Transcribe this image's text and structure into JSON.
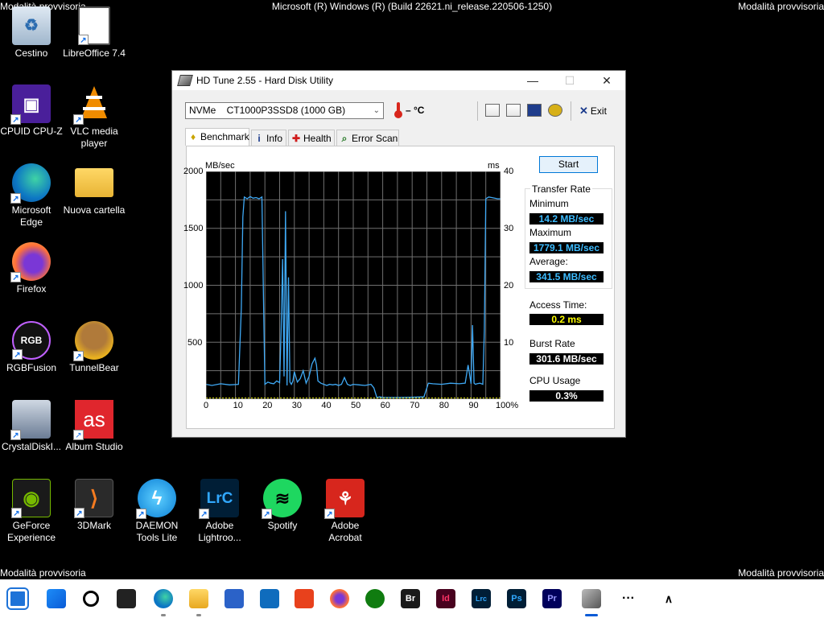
{
  "screen": {
    "safe_mode_label": "Modalità provvisoria",
    "build_text": "Microsoft (R) Windows (R) (Build 22621.ni_release.220506-1250)"
  },
  "desktop": {
    "icons": [
      {
        "label": "Cestino",
        "icon": "recycle-bin-icon"
      },
      {
        "label": "LibreOffice 7.4",
        "icon": "libreoffice-icon"
      },
      {
        "label": "CPUID CPU-Z",
        "icon": "cpuz-icon"
      },
      {
        "label": "VLC media player",
        "icon": "vlc-icon"
      },
      {
        "label": "Microsoft Edge",
        "icon": "edge-icon"
      },
      {
        "label": "Nuova cartella",
        "icon": "folder-icon"
      },
      {
        "label": "Firefox",
        "icon": "firefox-icon"
      },
      {
        "label": "RGBFusion",
        "icon": "rgbfusion-icon"
      },
      {
        "label": "TunnelBear",
        "icon": "tunnelbear-icon"
      },
      {
        "label": "CrystalDiskI...",
        "icon": "crystaldisk-icon"
      },
      {
        "label": "Album Studio",
        "icon": "album-studio-icon"
      },
      {
        "label": "GeForce Experience",
        "icon": "geforce-icon"
      },
      {
        "label": "3DMark",
        "icon": "3dmark-icon"
      },
      {
        "label": "DAEMON Tools Lite",
        "icon": "daemon-tools-icon"
      },
      {
        "label": "Adobe Lightroo...",
        "icon": "lightroom-icon",
        "glyph": "LrC"
      },
      {
        "label": "Spotify",
        "icon": "spotify-icon"
      },
      {
        "label": "Adobe Acrobat",
        "icon": "acrobat-icon"
      },
      {
        "label": "",
        "icon": "album-studio-glyph",
        "glyph": "as"
      },
      {
        "label": "",
        "icon": "rgb-glyph",
        "glyph": "RGB"
      }
    ]
  },
  "window": {
    "title": "HD Tune 2.55 - Hard Disk Utility",
    "controls": {
      "minimize": "—",
      "maximize": "☐",
      "close": "✕"
    },
    "drive_select": "NVMe    CT1000P3SSD8 (1000 GB)",
    "temperature": "– °C",
    "exit_label": "Exit",
    "tabs": [
      {
        "label": "Benchmark",
        "active": true
      },
      {
        "label": "Info"
      },
      {
        "label": "Health"
      },
      {
        "label": "Error Scan"
      }
    ],
    "start_label": "Start",
    "transfer_rate": {
      "title": "Transfer Rate",
      "min_label": "Minimum",
      "min_value": "14.2 MB/sec",
      "max_label": "Maximum",
      "max_value": "1779.1 MB/sec",
      "avg_label": "Average:",
      "avg_value": "341.5 MB/sec"
    },
    "access_time": {
      "label": "Access Time:",
      "value": "0.2 ms"
    },
    "burst_rate": {
      "label": "Burst Rate",
      "value": "301.6 MB/sec"
    },
    "cpu_usage": {
      "label": "CPU Usage",
      "value": "0.3%"
    }
  },
  "chart_data": {
    "type": "line",
    "ylabel_left": "MB/sec",
    "ylabel_right": "ms",
    "ylim_left": [
      0,
      2000
    ],
    "ylim_right": [
      0,
      40
    ],
    "yticks_left": [
      "2000",
      "1500",
      "1000",
      "500"
    ],
    "yticks_right": [
      "40",
      "30",
      "20",
      "10"
    ],
    "xlim": [
      0,
      100
    ],
    "xticks": [
      "0",
      "10",
      "20",
      "30",
      "40",
      "50",
      "60",
      "70",
      "80",
      "90",
      "100%"
    ],
    "grid": true,
    "colors": {
      "background": "#000000",
      "grid": "#707070",
      "transfer": "#3fa9f5",
      "access": "#e8e800"
    },
    "series": [
      {
        "axis": "left",
        "x": [
          0,
          2,
          5,
          8,
          11,
          12,
          12.5,
          13,
          14,
          15,
          16,
          17,
          18,
          19,
          19.5,
          20,
          21,
          22,
          23,
          24,
          25,
          25.5,
          26,
          26.5,
          27,
          27.5,
          28,
          28.5,
          29,
          29.5,
          30,
          31,
          32,
          33,
          34,
          35,
          36,
          37,
          37.5,
          38,
          39,
          40,
          41,
          42,
          43,
          44,
          45,
          46,
          47,
          48,
          49,
          50,
          52,
          54,
          56,
          57,
          58,
          59,
          60,
          65,
          70,
          74,
          75,
          75.5,
          77,
          80,
          83,
          86,
          88,
          89,
          90,
          90.5,
          91,
          91.5,
          92,
          93,
          94,
          94.5,
          95,
          96,
          97,
          98,
          99,
          100
        ],
        "values": [
          130,
          120,
          135,
          125,
          130,
          800,
          1600,
          1775,
          1760,
          1779,
          1765,
          1770,
          1760,
          1775,
          900,
          130,
          150,
          140,
          135,
          160,
          145,
          600,
          1230,
          200,
          1650,
          120,
          1070,
          150,
          130,
          160,
          240,
          150,
          180,
          250,
          140,
          200,
          310,
          360,
          300,
          160,
          140,
          130,
          120,
          130,
          125,
          130,
          120,
          130,
          190,
          130,
          120,
          130,
          125,
          120,
          130,
          100,
          14,
          20,
          15,
          14,
          16,
          20,
          100,
          140,
          135,
          130,
          140,
          135,
          140,
          300,
          135,
          650,
          140,
          130,
          135,
          140,
          130,
          600,
          1760,
          1775,
          1770,
          1765,
          1760,
          1760
        ]
      },
      {
        "axis": "right",
        "x": [
          0,
          10,
          20,
          30,
          40,
          50,
          60,
          70,
          80,
          90,
          100
        ],
        "values": [
          0.2,
          0.2,
          0.2,
          0.2,
          0.2,
          0.2,
          0.2,
          0.2,
          0.2,
          0.2,
          0.2
        ]
      }
    ]
  },
  "taskbar": {
    "items": [
      {
        "name": "taskview-icon",
        "glyph": ""
      },
      {
        "name": "start-icon",
        "glyph": ""
      },
      {
        "name": "search-icon",
        "glyph": ""
      },
      {
        "name": "widgets-icon",
        "glyph": ""
      },
      {
        "name": "edge-taskbar-icon",
        "glyph": ""
      },
      {
        "name": "explorer-icon",
        "glyph": ""
      },
      {
        "name": "store-icon",
        "glyph": ""
      },
      {
        "name": "mail-icon",
        "glyph": ""
      },
      {
        "name": "office-icon",
        "glyph": ""
      },
      {
        "name": "firefox-taskbar-icon",
        "glyph": ""
      },
      {
        "name": "xbox-icon",
        "glyph": ""
      },
      {
        "name": "bridge-icon",
        "glyph": "Br"
      },
      {
        "name": "indesign-icon",
        "glyph": "Id"
      },
      {
        "name": "lightroom-taskbar-icon",
        "glyph": "Lrc"
      },
      {
        "name": "photoshop-icon",
        "glyph": "Ps"
      },
      {
        "name": "premiere-icon",
        "glyph": "Pr"
      },
      {
        "name": "hdtune-taskbar-icon",
        "glyph": ""
      },
      {
        "name": "more-icon",
        "glyph": "···"
      },
      {
        "name": "tray-chevron-icon",
        "glyph": "∧"
      }
    ]
  }
}
